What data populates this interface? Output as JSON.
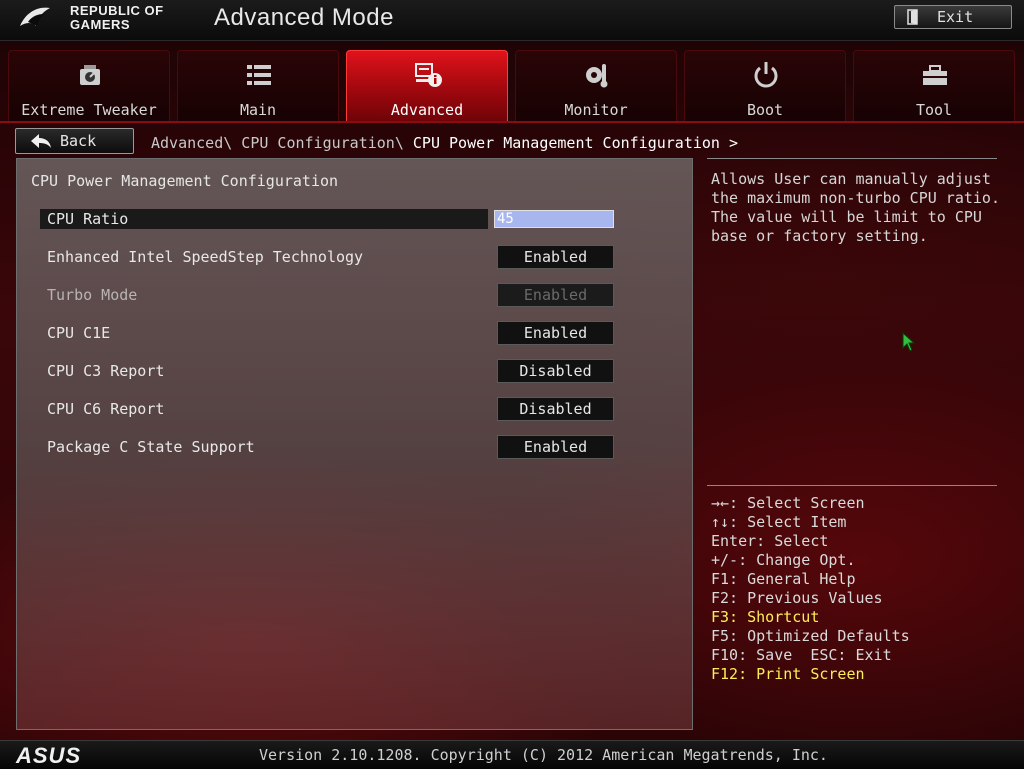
{
  "header": {
    "brand_line1": "REPUBLIC OF",
    "brand_line2": "GAMERS",
    "title": "Advanced Mode",
    "exit_label": "Exit"
  },
  "tabs": [
    {
      "label": "Extreme Tweaker",
      "icon": "gauge-icon",
      "active": false
    },
    {
      "label": "Main",
      "icon": "list-icon",
      "active": false
    },
    {
      "label": "Advanced",
      "icon": "advanced-info-icon",
      "active": true
    },
    {
      "label": "Monitor",
      "icon": "monitor-gear-icon",
      "active": false
    },
    {
      "label": "Boot",
      "icon": "power-icon",
      "active": false
    },
    {
      "label": "Tool",
      "icon": "toolbox-icon",
      "active": false
    }
  ],
  "nav": {
    "back_label": "Back",
    "breadcrumb_path": "Advanced\\ CPU Configuration\\ ",
    "breadcrumb_current": "CPU Power Management Configuration >"
  },
  "main": {
    "section_title": "CPU Power Management Configuration",
    "rows": [
      {
        "label": "CPU Ratio",
        "value": "45",
        "type": "input",
        "selected": true,
        "disabled": false
      },
      {
        "label": "Enhanced Intel SpeedStep Technology",
        "value": "Enabled",
        "type": "select",
        "selected": false,
        "disabled": false
      },
      {
        "label": "Turbo Mode",
        "value": "Enabled",
        "type": "select",
        "selected": false,
        "disabled": true
      },
      {
        "label": "CPU C1E",
        "value": "Enabled",
        "type": "select",
        "selected": false,
        "disabled": false
      },
      {
        "label": "CPU C3 Report",
        "value": "Disabled",
        "type": "select",
        "selected": false,
        "disabled": false
      },
      {
        "label": "CPU C6 Report",
        "value": "Disabled",
        "type": "select",
        "selected": false,
        "disabled": false
      },
      {
        "label": "Package C State Support",
        "value": "Enabled",
        "type": "select",
        "selected": false,
        "disabled": false
      }
    ]
  },
  "help": {
    "text": "Allows User can manually adjust the maximum non-turbo CPU ratio. The value will be limit to CPU base or factory setting."
  },
  "keys": [
    {
      "text": "→←: Select Screen",
      "highlight": false
    },
    {
      "text": "↑↓: Select Item",
      "highlight": false
    },
    {
      "text": "Enter: Select",
      "highlight": false
    },
    {
      "text": "+/-: Change Opt.",
      "highlight": false
    },
    {
      "text": "F1: General Help",
      "highlight": false
    },
    {
      "text": "F2: Previous Values",
      "highlight": false
    },
    {
      "text": "F3: Shortcut",
      "highlight": true
    },
    {
      "text": "F5: Optimized Defaults",
      "highlight": false
    },
    {
      "text": "F10: Save  ESC: Exit",
      "highlight": false
    },
    {
      "text": "F12: Print Screen",
      "highlight": true
    }
  ],
  "footer": {
    "brand": "ASUS",
    "version": "Version 2.10.1208. Copyright (C) 2012 American Megatrends, Inc."
  },
  "colors": {
    "accent_red": "#e0121b",
    "highlight_yellow": "#ffee55",
    "input_blue": "#a8b6f0"
  }
}
